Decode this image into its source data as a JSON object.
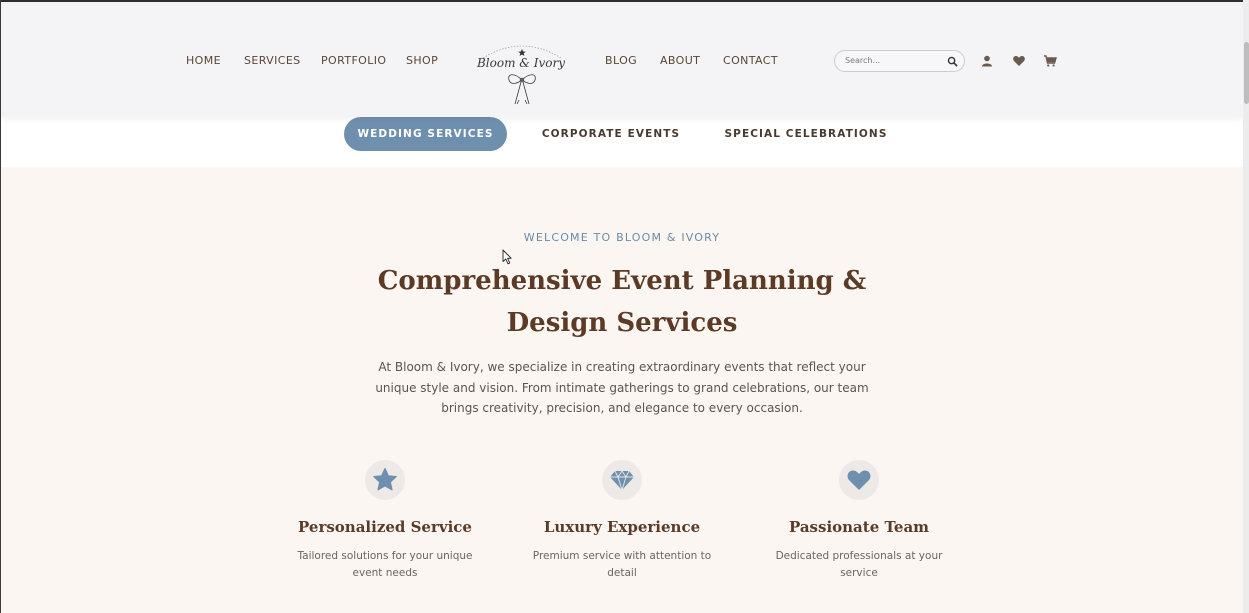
{
  "nav": {
    "left": [
      "HOME",
      "SERVICES",
      "PORTFOLIO",
      "SHOP"
    ],
    "right": [
      "BLOG",
      "ABOUT",
      "CONTACT"
    ],
    "logo_text": "Bloom & Ivory",
    "logo_icon": "bow-icon"
  },
  "search": {
    "placeholder": "Search...",
    "icon": "search-icon"
  },
  "header_icons": [
    "user-icon",
    "heart-icon",
    "cart-icon"
  ],
  "tabs": [
    {
      "label": "WEDDING SERVICES",
      "active": true
    },
    {
      "label": "CORPORATE EVENTS",
      "active": false
    },
    {
      "label": "SPECIAL CELEBRATIONS",
      "active": false
    }
  ],
  "hero": {
    "eyebrow": "WELCOME TO BLOOM & IVORY",
    "title": "Comprehensive Event Planning & Design Services",
    "intro": "At Bloom & Ivory, we specialize in creating extraordinary events that reflect your unique style and vision. From intimate gatherings to grand celebrations, our team brings creativity, precision, and elegance to every occasion."
  },
  "features": [
    {
      "icon": "star-icon",
      "title": "Personalized Service",
      "desc": "Tailored solutions for your unique event needs"
    },
    {
      "icon": "diamond-icon",
      "title": "Luxury Experience",
      "desc": "Premium service with attention to detail"
    },
    {
      "icon": "heart-icon",
      "title": "Passionate Team",
      "desc": "Dedicated professionals at your service"
    }
  ],
  "colors": {
    "accent": "#6f8fae",
    "heading": "#5b3a26",
    "nav_text": "#5a4536",
    "page_bg": "#fbf6f1",
    "header_bg": "#f4f4f7"
  }
}
